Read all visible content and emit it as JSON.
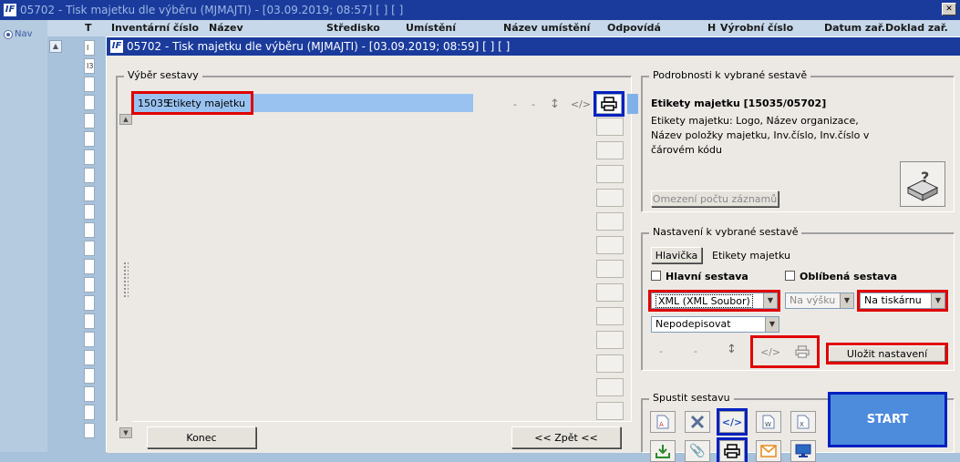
{
  "background_window": {
    "title": "05702 - Tisk majetku dle výběru (MJMAJTI) - [03.09.2019; 08:57]  [ ]  [ ]",
    "nav_label": "Nav",
    "columns": [
      "T",
      "Inventární číslo",
      "Název",
      "Středisko",
      "Umístění",
      "Název umístění",
      "Odpovídá",
      "H",
      "Výrobní číslo",
      "Datum zař.",
      "Doklad zař."
    ],
    "row_cells": [
      "I",
      "I3"
    ]
  },
  "dialog": {
    "title": "05702 - Tisk majetku dle výběru (MJMAJTI) - [03.09.2019; 08:59]  [ ]  [ ]",
    "left_group_label": "Výběr sestavy",
    "reports": [
      {
        "id": "15035",
        "name": "Etikety majetku"
      }
    ],
    "row_icon_dashes": [
      "-",
      "-"
    ],
    "close_button": "Konec",
    "back_button": "<< Zpět <<"
  },
  "details": {
    "group_label": "Podrobnosti k vybrané sestavě",
    "title": "Etikety majetku [15035/05702]",
    "description": "Etikety majetku: Logo, Název organizace, Název položky majetku, Inv.číslo, Inv.číslo v čárovém kódu",
    "limit_button": "Omezení počtu záznamů"
  },
  "settings": {
    "group_label": "Nastavení k vybrané sestavě",
    "header_button": "Hlavička",
    "header_value": "Etikety majetku",
    "main_report_label": "Hlavní sestava",
    "favorite_label": "Oblíbená sestava",
    "format_select": "XML (XML Soubor)",
    "orientation_select": "Na výšku",
    "output_select": "Na tiskárnu",
    "sign_select": "Nepodepisovat",
    "dashes": [
      "-",
      "-"
    ],
    "save_button": "Uložit nastavení"
  },
  "run": {
    "group_label": "Spustit sestavu",
    "start_button": "START"
  },
  "colors": {
    "titlebar": "#1a3b9c",
    "selection": "#99c2f0",
    "start": "#4d8bdc",
    "highlight_red": "#e00000",
    "highlight_blue": "#0020c0"
  }
}
